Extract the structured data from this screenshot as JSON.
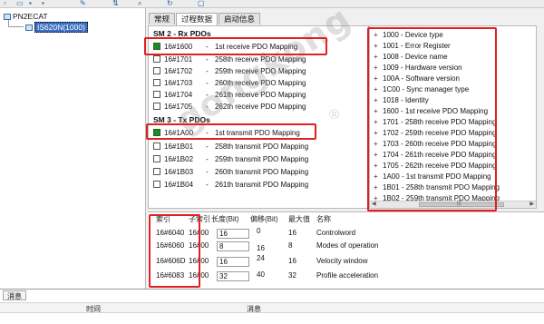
{
  "toolbar": {
    "icons": [
      "new-icon",
      "open-icon",
      "save-icon",
      "save-all-icon",
      "edit-icon",
      "connect-icon",
      "scan-icon",
      "refresh-icon",
      "window-icon"
    ]
  },
  "tree": {
    "root_label": "PN2ECAT",
    "child_label": "IS620N(1000)"
  },
  "tabs": [
    "常规",
    "过程数据",
    "启动信息"
  ],
  "pdo": {
    "sm2_header": "SM 2 - Rx PDOs",
    "rx": [
      {
        "index": "16#1600",
        "name": "1st receive PDO Mapping",
        "checked": true
      },
      {
        "index": "16#1701",
        "name": "258th receive PDO Mapping",
        "checked": false
      },
      {
        "index": "16#1702",
        "name": "259th receive PDO Mapping",
        "checked": false
      },
      {
        "index": "16#1703",
        "name": "260th receive PDO Mapping",
        "checked": false
      },
      {
        "index": "16#1704",
        "name": "261th receive PDO Mapping",
        "checked": false
      },
      {
        "index": "16#1705",
        "name": "262th receive PDO Mapping",
        "checked": false
      }
    ],
    "sm3_header": "SM 3 - Tx PDOs",
    "tx": [
      {
        "index": "16#1A00",
        "name": "1st transmit PDO Mapping",
        "checked": true
      },
      {
        "index": "16#1B01",
        "name": "258th transmit PDO Mapping",
        "checked": false
      },
      {
        "index": "16#1B02",
        "name": "259th transmit PDO Mapping",
        "checked": false
      },
      {
        "index": "16#1B03",
        "name": "260th transmit PDO Mapping",
        "checked": false
      },
      {
        "index": "16#1B04",
        "name": "261th transmit PDO Mapping",
        "checked": false
      }
    ]
  },
  "od": [
    "1000 - Device type",
    "1001 - Error Register",
    "1008 - Device name",
    "1009 - Hardware version",
    "100A - Software version",
    "1C00 - Sync manager type",
    "1018 - Identity",
    "1600 - 1st receive PDO Mapping",
    "1701 - 258th receive PDO Mapping",
    "1702 - 259th receive PDO Mapping",
    "1703 - 260th receive PDO Mapping",
    "1704 - 261th receive PDO Mapping",
    "1705 - 262th receive PDO Mapping",
    "1A00 - 1st transmit PDO Mapping",
    "1B01 - 258th transmit PDO Mapping",
    "1B02 - 259th transmit PDO Mapping"
  ],
  "mapping": {
    "headers": [
      "索引",
      "子索引",
      "长度(Bit)",
      "偏移(Bit)",
      "最大值",
      "名称"
    ],
    "rows": [
      {
        "index": "16#6040",
        "subindex": "16#00",
        "length": "16",
        "offset": "0",
        "max": "16",
        "name": "Controlword"
      },
      {
        "index": "16#6060",
        "subindex": "16#00",
        "length": "8",
        "offset": "16",
        "max": "8",
        "name": "Modes of operation"
      },
      {
        "index": "16#606D",
        "subindex": "16#00",
        "length": "16",
        "offset": "24",
        "max": "16",
        "name": "Velocity window"
      },
      {
        "index": "16#6083",
        "subindex": "16#00",
        "length": "32",
        "offset": "40",
        "max": "32",
        "name": "Profile acceleration"
      }
    ]
  },
  "messages": {
    "tab_label": "消息",
    "col_time": "时间",
    "col_message": "消息"
  },
  "watermark": {
    "text": "gongkong",
    "reg": "®"
  },
  "colors": {
    "highlight_red": "#e02020",
    "check_green": "#1e8a2a",
    "selection_blue": "#3b6fbf"
  }
}
